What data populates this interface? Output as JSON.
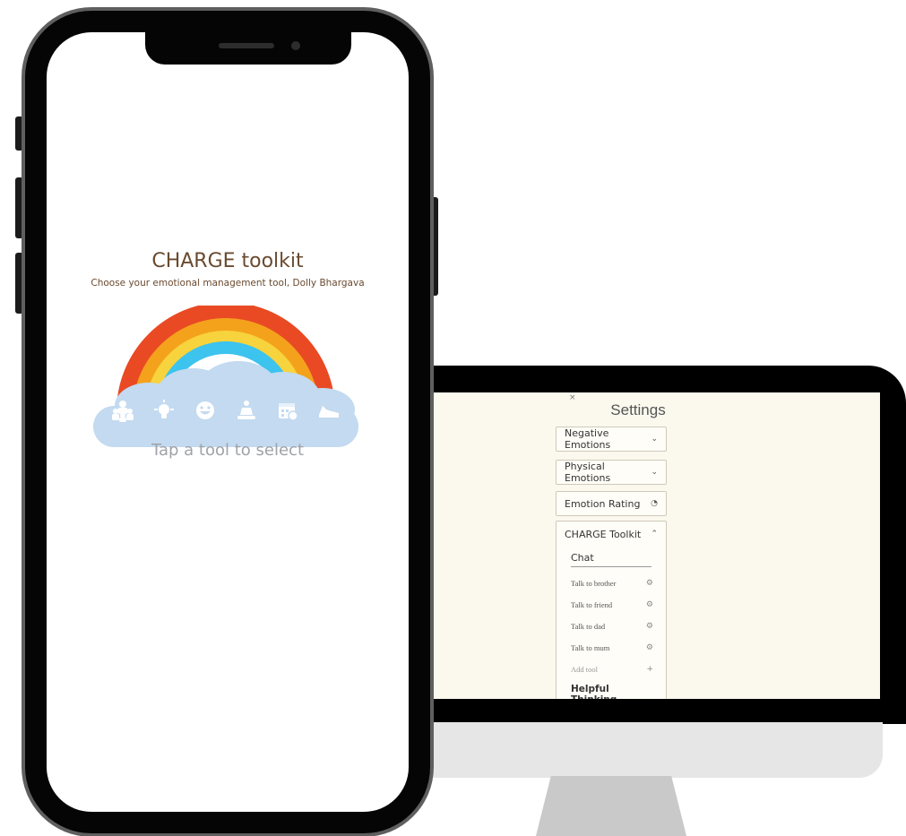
{
  "phone": {
    "app_title": "CHARGE toolkit",
    "app_subtitle": "Choose your emotional management tool, Dolly Bhargava",
    "tap_hint": "Tap a tool to select",
    "tools": [
      {
        "icon": "people-group-icon"
      },
      {
        "icon": "lightbulb-icon"
      },
      {
        "icon": "smiley-face-icon"
      },
      {
        "icon": "meditation-icon"
      },
      {
        "icon": "calendar-icon"
      },
      {
        "icon": "sneaker-icon"
      }
    ],
    "rainbow_colors": [
      "#e94a24",
      "#f4a21c",
      "#f7d33d",
      "#3cc3ee",
      "#ffffff"
    ],
    "cloud_color": "#c3daf0"
  },
  "desktop": {
    "settings": {
      "close_symbol": "×",
      "title": "Settings",
      "sections": [
        {
          "label": "Negative Emotions",
          "icon": "chevron-down-icon",
          "symbol": "⌄"
        },
        {
          "label": "Physical Emotions",
          "icon": "chevron-down-icon",
          "symbol": "⌄"
        },
        {
          "label": "Emotion Rating",
          "icon": "gauge-icon",
          "symbol": "◔"
        }
      ],
      "expanded": {
        "label": "CHARGE Toolkit",
        "symbol": "⌃",
        "group": "Chat",
        "items": [
          {
            "label": "Talk to brother",
            "symbol": "⚙"
          },
          {
            "label": "Talk to friend",
            "symbol": "⚙"
          },
          {
            "label": "Talk to dad",
            "symbol": "⚙"
          },
          {
            "label": "Talk to mum",
            "symbol": "⚙"
          }
        ],
        "add_tool": {
          "label": "Add tool",
          "symbol": "+"
        },
        "next_group": "Helpful Thinking"
      }
    },
    "screen_background": "#fbf8ee"
  }
}
